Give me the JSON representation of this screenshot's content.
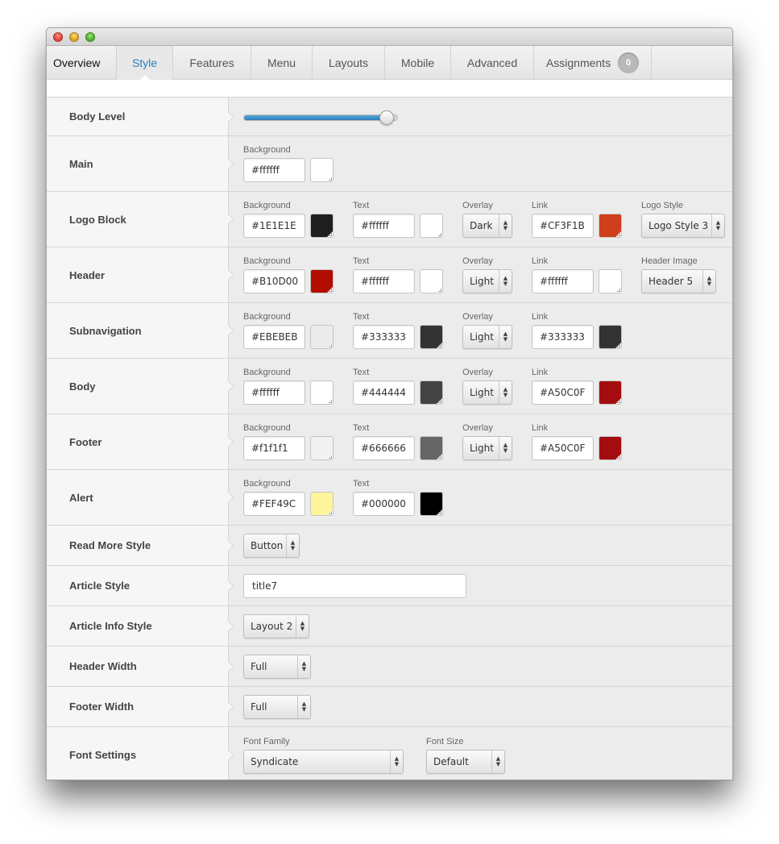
{
  "tabs": [
    {
      "label": "Overview"
    },
    {
      "label": "Style"
    },
    {
      "label": "Features"
    },
    {
      "label": "Menu"
    },
    {
      "label": "Layouts"
    },
    {
      "label": "Mobile"
    },
    {
      "label": "Advanced"
    },
    {
      "label": "Assignments",
      "badge": "0"
    }
  ],
  "active_tab": "Style",
  "body_level": {
    "label": "Body Level",
    "value_fraction": 0.93
  },
  "main": {
    "label": "Main",
    "background": {
      "label": "Background",
      "value": "#ffffff",
      "color": "#ffffff"
    }
  },
  "logo_block": {
    "label": "Logo Block",
    "background": {
      "label": "Background",
      "value": "#1E1E1E",
      "color": "#1e1e1e"
    },
    "text": {
      "label": "Text",
      "value": "#ffffff",
      "color": "#ffffff"
    },
    "overlay": {
      "label": "Overlay",
      "value": "Dark"
    },
    "link": {
      "label": "Link",
      "value": "#CF3F1B",
      "color": "#cf3f1b"
    },
    "logo_style": {
      "label": "Logo Style",
      "value": "Logo Style 3"
    }
  },
  "header": {
    "label": "Header",
    "background": {
      "label": "Background",
      "value": "#B10D00",
      "color": "#b10d00"
    },
    "text": {
      "label": "Text",
      "value": "#ffffff",
      "color": "#ffffff"
    },
    "overlay": {
      "label": "Overlay",
      "value": "Light"
    },
    "link": {
      "label": "Link",
      "value": "#ffffff",
      "color": "#ffffff"
    },
    "header_image": {
      "label": "Header Image",
      "value": "Header 5"
    }
  },
  "subnavigation": {
    "label": "Subnavigation",
    "background": {
      "label": "Background",
      "value": "#EBEBEB",
      "color": "#ebebeb"
    },
    "text": {
      "label": "Text",
      "value": "#333333",
      "color": "#333333"
    },
    "overlay": {
      "label": "Overlay",
      "value": "Light"
    },
    "link": {
      "label": "Link",
      "value": "#333333",
      "color": "#333333"
    }
  },
  "body": {
    "label": "Body",
    "background": {
      "label": "Background",
      "value": "#ffffff",
      "color": "#ffffff"
    },
    "text": {
      "label": "Text",
      "value": "#444444",
      "color": "#444444"
    },
    "overlay": {
      "label": "Overlay",
      "value": "Light"
    },
    "link": {
      "label": "Link",
      "value": "#A50C0F",
      "color": "#a50c0f"
    }
  },
  "footer": {
    "label": "Footer",
    "background": {
      "label": "Background",
      "value": "#f1f1f1",
      "color": "#f1f1f1"
    },
    "text": {
      "label": "Text",
      "value": "#666666",
      "color": "#666666"
    },
    "overlay": {
      "label": "Overlay",
      "value": "Light"
    },
    "link": {
      "label": "Link",
      "value": "#A50C0F",
      "color": "#a50c0f"
    }
  },
  "alert": {
    "label": "Alert",
    "background": {
      "label": "Background",
      "value": "#FEF49C",
      "color": "#fef49c"
    },
    "text": {
      "label": "Text",
      "value": "#000000",
      "color": "#000000"
    }
  },
  "read_more_style": {
    "label": "Read More Style",
    "value": "Button"
  },
  "article_style": {
    "label": "Article Style",
    "value": "title7"
  },
  "article_info_style": {
    "label": "Article Info Style",
    "value": "Layout 2"
  },
  "header_width": {
    "label": "Header Width",
    "value": "Full"
  },
  "footer_width": {
    "label": "Footer Width",
    "value": "Full"
  },
  "font_settings": {
    "label": "Font Settings",
    "font_family": {
      "label": "Font Family",
      "value": "Syndicate"
    },
    "font_size": {
      "label": "Font Size",
      "value": "Default"
    }
  }
}
